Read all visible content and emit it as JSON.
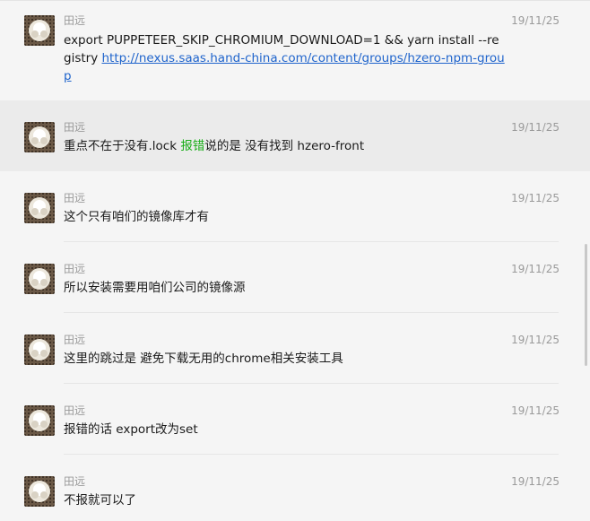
{
  "messages": [
    {
      "sender": "田远",
      "time": "19/11/25",
      "text_prefix": "export PUPPETEER_SKIP_CHROMIUM_DOWNLOAD=1 && yarn install --registry ",
      "link": "http://nexus.saas.hand-china.com/content/groups/hzero-npm-group"
    },
    {
      "sender": "田远",
      "time": "19/11/25",
      "text_before": "重点不在于没有.lock  ",
      "keyword": "报错",
      "text_after": "说的是 没有找到 hzero-front"
    },
    {
      "sender": "田远",
      "time": "19/11/25",
      "text": "这个只有咱们的镜像库才有"
    },
    {
      "sender": "田远",
      "time": "19/11/25",
      "text": "所以安装需要用咱们公司的镜像源"
    },
    {
      "sender": "田远",
      "time": "19/11/25",
      "text": "这里的跳过是 避免下载无用的chrome相关安装工具"
    },
    {
      "sender": "田远",
      "time": "19/11/25",
      "text": "报错的话 export改为set"
    },
    {
      "sender": "田远",
      "time": "19/11/25",
      "text": "不报就可以了"
    }
  ],
  "colors": {
    "background": "#f5f5f5",
    "highlight_row": "#ebebeb",
    "link": "#1f64cc",
    "keyword": "#1aad19",
    "meta_text": "#9a9a9a"
  },
  "icons": {
    "avatar": "avatar-image-icon"
  }
}
